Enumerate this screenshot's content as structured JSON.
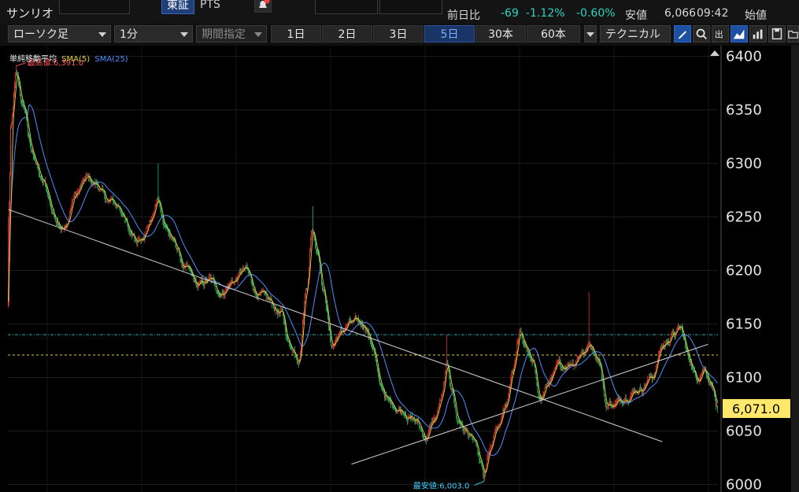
{
  "header": {
    "stock_name": "サンリオ",
    "exchange_tabs": [
      "東証",
      "PTS"
    ],
    "quote": {
      "prev_label": "前日比",
      "change": "-69",
      "change_pct": "-1.12%",
      "change_pct2": "-0.60%",
      "low_label": "安値",
      "low_value": "6,066",
      "low_time": "09:42",
      "open_label": "始値"
    }
  },
  "toolbar": {
    "chart_type": "ローソク足",
    "interval": "1分",
    "period_specify": "期間指定",
    "periods": [
      "1日",
      "2日",
      "3日",
      "5日",
      "30本",
      "60本"
    ],
    "active_period": "5日",
    "technical": "テクニカル"
  },
  "legend": {
    "label": "単純移動平均",
    "sma5": "SMA(5)",
    "sma25": "SMA(25)"
  },
  "colors": {
    "up": "#ff3b3b",
    "down": "#2ecc71",
    "sma5": "#e6d23a",
    "sma25": "#4f8fff",
    "hline_cyan": "#1fb5b5",
    "hline_yellow": "#e6d23a",
    "price_tag_bg": "#ffe86a",
    "trend": "#d0d0d0",
    "change_color": "#2dd3c0",
    "high_label": "#ff5555",
    "low_label": "#3fd0ff"
  },
  "chart_data": {
    "type": "candlestick",
    "ylim": [
      5993,
      6410
    ],
    "yticks": [
      6000,
      6050,
      6100,
      6150,
      6200,
      6250,
      6300,
      6350,
      6400
    ],
    "current_price": "6,071.0",
    "current_value": 6071.0,
    "high_annotation": "最高値:6,391.0",
    "low_annotation": "最安値:6,003.0",
    "hlines": [
      {
        "value": 6140,
        "color": "cyan"
      },
      {
        "value": 6121,
        "color": "yellow"
      }
    ],
    "trendlines": [
      {
        "from": {
          "i": 0,
          "v": 6257
        },
        "to": {
          "i": 829,
          "v": 6040
        }
      },
      {
        "from": {
          "i": 435,
          "v": 6019
        },
        "to": {
          "i": 887,
          "v": 6131
        }
      }
    ],
    "n_bars": 900,
    "anchors": [
      [
        0,
        6170
      ],
      [
        3,
        6330
      ],
      [
        10,
        6380
      ],
      [
        20,
        6350
      ],
      [
        30,
        6310
      ],
      [
        45,
        6280
      ],
      [
        60,
        6250
      ],
      [
        72,
        6240
      ],
      [
        85,
        6270
      ],
      [
        100,
        6285
      ],
      [
        112,
        6280
      ],
      [
        125,
        6265
      ],
      [
        140,
        6260
      ],
      [
        155,
        6235
      ],
      [
        170,
        6230
      ],
      [
        180,
        6245
      ],
      [
        190,
        6265
      ],
      [
        200,
        6240
      ],
      [
        210,
        6225
      ],
      [
        225,
        6200
      ],
      [
        240,
        6185
      ],
      [
        255,
        6190
      ],
      [
        270,
        6180
      ],
      [
        285,
        6190
      ],
      [
        300,
        6200
      ],
      [
        315,
        6180
      ],
      [
        330,
        6170
      ],
      [
        345,
        6160
      ],
      [
        357,
        6130
      ],
      [
        368,
        6120
      ],
      [
        378,
        6185
      ],
      [
        385,
        6240
      ],
      [
        392,
        6220
      ],
      [
        400,
        6180
      ],
      [
        410,
        6130
      ],
      [
        420,
        6140
      ],
      [
        432,
        6150
      ],
      [
        442,
        6150
      ],
      [
        452,
        6150
      ],
      [
        462,
        6130
      ],
      [
        472,
        6090
      ],
      [
        485,
        6075
      ],
      [
        500,
        6070
      ],
      [
        515,
        6060
      ],
      [
        530,
        6045
      ],
      [
        540,
        6060
      ],
      [
        550,
        6080
      ],
      [
        556,
        6110
      ],
      [
        562,
        6090
      ],
      [
        570,
        6060
      ],
      [
        580,
        6050
      ],
      [
        590,
        6040
      ],
      [
        598,
        6020
      ],
      [
        603,
        6005
      ],
      [
        610,
        6030
      ],
      [
        620,
        6050
      ],
      [
        630,
        6070
      ],
      [
        640,
        6110
      ],
      [
        648,
        6140
      ],
      [
        655,
        6130
      ],
      [
        665,
        6110
      ],
      [
        675,
        6080
      ],
      [
        685,
        6095
      ],
      [
        700,
        6110
      ],
      [
        715,
        6115
      ],
      [
        728,
        6125
      ],
      [
        738,
        6130
      ],
      [
        748,
        6120
      ],
      [
        758,
        6075
      ],
      [
        770,
        6075
      ],
      [
        785,
        6085
      ],
      [
        800,
        6090
      ],
      [
        815,
        6100
      ],
      [
        830,
        6130
      ],
      [
        842,
        6140
      ],
      [
        852,
        6145
      ],
      [
        862,
        6120
      ],
      [
        872,
        6100
      ],
      [
        882,
        6110
      ],
      [
        892,
        6095
      ],
      [
        899,
        6071
      ]
    ]
  }
}
